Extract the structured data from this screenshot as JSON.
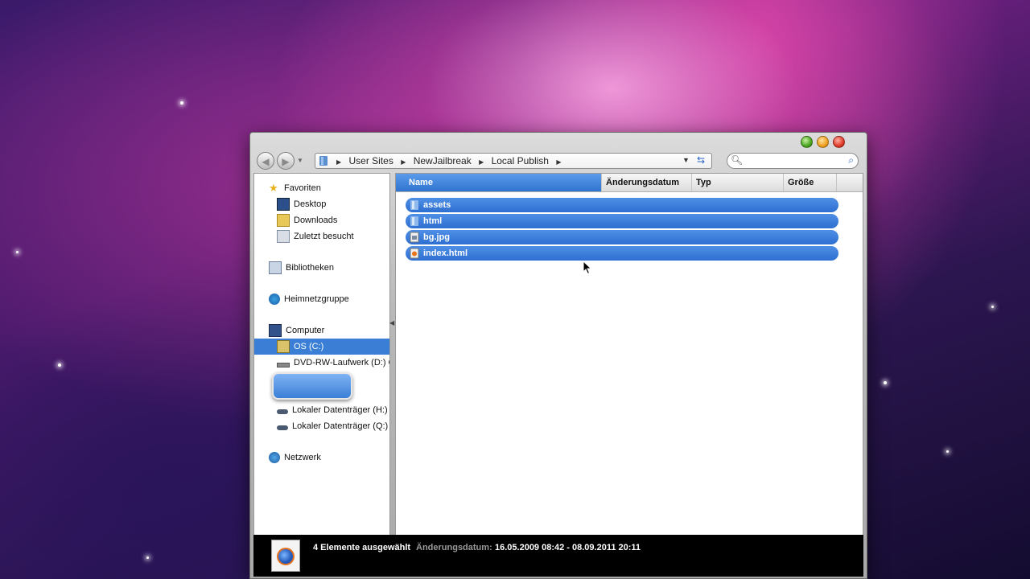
{
  "window": {
    "traffic_lights": [
      "minimize",
      "zoom",
      "close"
    ]
  },
  "toolbar": {
    "back_icon": "back-arrow-icon",
    "forward_icon": "forward-arrow-icon",
    "breadcrumbs": [
      "User Sites",
      "NewJailbreak",
      "Local Publish"
    ],
    "search_placeholder": ""
  },
  "nav": {
    "favorites_title": "Favoriten",
    "favorites": [
      "Desktop",
      "Downloads",
      "Zuletzt besucht"
    ],
    "libraries": "Bibliotheken",
    "homegroup": "Heimnetzgruppe",
    "computer": "Computer",
    "drives": [
      "OS (C:)",
      "DVD-RW-Laufwerk (D:) C"
    ],
    "drives_more": [
      "Lokaler Datenträger (H:)",
      "Lokaler Datenträger (Q:)"
    ],
    "network": "Netzwerk",
    "selected": "OS (C:)"
  },
  "columns": [
    "Name",
    "Änderungsdatum",
    "Typ",
    "Größe"
  ],
  "files": [
    {
      "name": "assets",
      "icon": "folder-icon"
    },
    {
      "name": "html",
      "icon": "folder-icon"
    },
    {
      "name": "bg.jpg",
      "icon": "image-file-icon"
    },
    {
      "name": "index.html",
      "icon": "html-file-icon"
    }
  ],
  "details": {
    "count": "4 Elemente ausgewählt",
    "date_label": "Änderungsdatum:",
    "date_value": "16.05.2009 08:42 - 08.09.2011 20:11"
  },
  "colors": {
    "selection": "#3a7fd5",
    "header_active": "#2f74d0"
  }
}
